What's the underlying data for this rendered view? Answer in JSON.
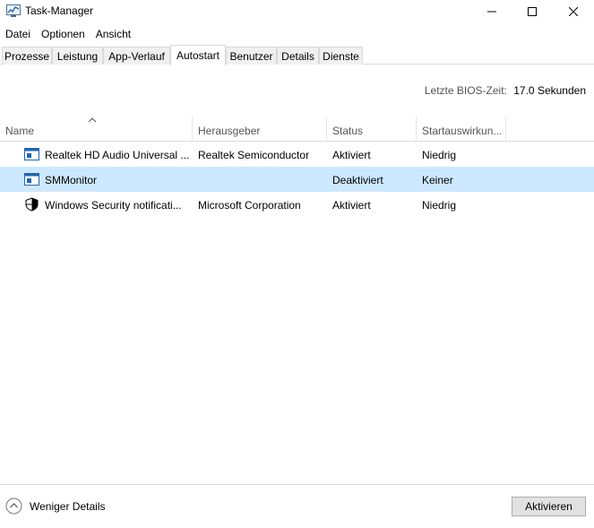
{
  "window": {
    "title": "Task-Manager",
    "icon": "task-manager-icon"
  },
  "menu": [
    "Datei",
    "Optionen",
    "Ansicht"
  ],
  "tabs": [
    {
      "label": "Prozesse",
      "active": false
    },
    {
      "label": "Leistung",
      "active": false
    },
    {
      "label": "App-Verlauf",
      "active": false
    },
    {
      "label": "Autostart",
      "active": true
    },
    {
      "label": "Benutzer",
      "active": false
    },
    {
      "label": "Details",
      "active": false
    },
    {
      "label": "Dienste",
      "active": false
    }
  ],
  "bios": {
    "label": "Letzte BIOS-Zeit:",
    "value": "17.0 Sekunden"
  },
  "columns": {
    "name": "Name",
    "publisher": "Herausgeber",
    "status": "Status",
    "impact": "Startauswirkun..."
  },
  "rows": [
    {
      "name": "Realtek HD Audio Universal ...",
      "publisher": "Realtek Semiconductor",
      "status": "Aktiviert",
      "impact": "Niedrig",
      "icon": "app-window-icon",
      "selected": false
    },
    {
      "name": "SMMonitor",
      "publisher": "",
      "status": "Deaktiviert",
      "impact": "Keiner",
      "icon": "app-window-icon",
      "selected": true
    },
    {
      "name": "Windows Security notificati...",
      "publisher": "Microsoft Corporation",
      "status": "Aktiviert",
      "impact": "Niedrig",
      "icon": "shield-icon",
      "selected": false
    }
  ],
  "footer": {
    "toggle_label": "Weniger Details",
    "action_button": "Aktivieren"
  },
  "colors": {
    "selected_row": "#cce8ff",
    "border": "#d9d9d9",
    "header_text": "#555555",
    "accent_blue": "#1e66b4"
  }
}
